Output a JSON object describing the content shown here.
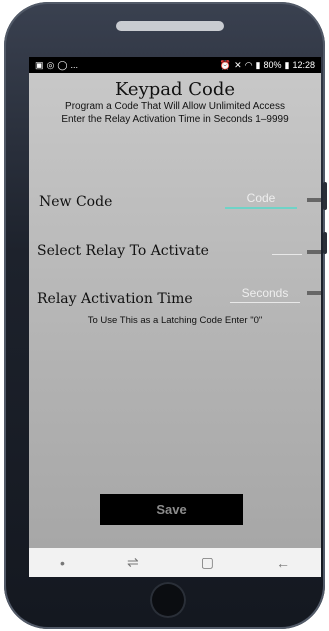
{
  "statusbar": {
    "left_ellipsis": "...",
    "battery": "80%",
    "time": "12:28"
  },
  "header": {
    "title": "Keypad Code",
    "subtitle_line1": "Program a Code That Will Allow Unlimited Access",
    "subtitle_line2": "Enter the Relay Activation Time in Seconds 1–9999"
  },
  "form": {
    "new_code_label": "New Code",
    "new_code_placeholder": "Code",
    "relay_label": "Select Relay To Activate",
    "relay_value": "",
    "activation_label": "Relay Activation Time",
    "activation_placeholder": "Seconds",
    "latching_note": "To Use This as a Latching Code Enter \"0\""
  },
  "save_label": "Save",
  "navbar": {
    "dot": "•",
    "recents": "⇌",
    "home": "▢",
    "back": "←"
  }
}
